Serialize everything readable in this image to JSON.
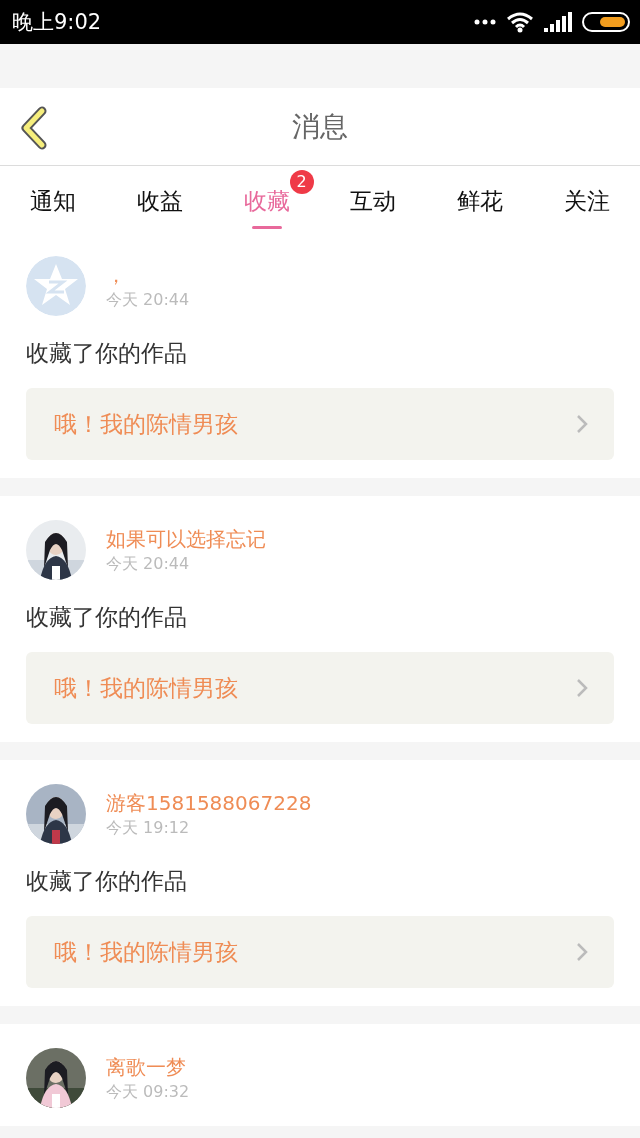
{
  "status_bar": {
    "time": "晚上9:02"
  },
  "header": {
    "title": "消息"
  },
  "tabs": [
    {
      "label": "通知",
      "selected": false
    },
    {
      "label": "收益",
      "selected": false
    },
    {
      "label": "收藏",
      "selected": true,
      "badge": "2"
    },
    {
      "label": "互动",
      "selected": false
    },
    {
      "label": "鲜花",
      "selected": false
    },
    {
      "label": "关注",
      "selected": false
    }
  ],
  "messages": [
    {
      "avatar": {
        "kind": "default"
      },
      "name": "，",
      "time": "今天 20:44",
      "action": "收藏了你的作品",
      "work": "哦！我的陈情男孩"
    },
    {
      "name": "如果可以选择忘记",
      "time": "今天 20:44",
      "action": "收藏了你的作品",
      "work": "哦！我的陈情男孩"
    },
    {
      "name": "游客1581588067228",
      "time": "今天 19:12",
      "action": "收藏了你的作品",
      "work": "哦！我的陈情男孩"
    },
    {
      "name": "离歌一梦",
      "time": "今天 09:32"
    }
  ]
}
